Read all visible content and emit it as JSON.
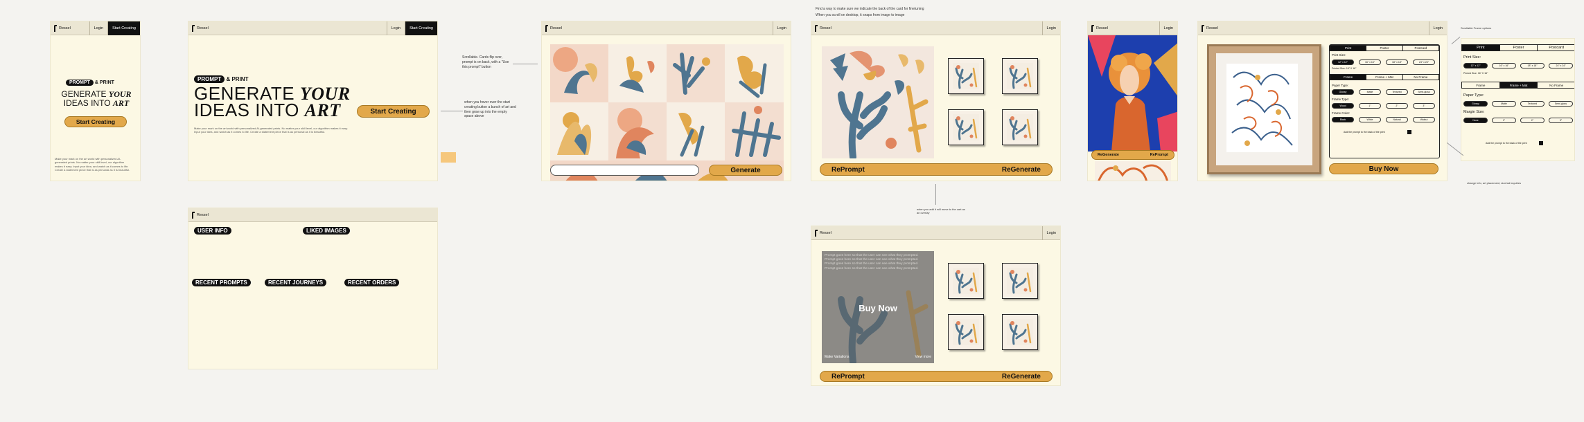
{
  "nav": {
    "brand": "Ressel",
    "login": "Login",
    "start": "Start Creating"
  },
  "hero": {
    "prompt_pill": "PROMPT",
    "print_tag": "& PRINT",
    "line1a": "GENERATE ",
    "line1b": "YOUR",
    "line2a": "IDEAS INTO ",
    "line2b": "ART",
    "cta": "Start Creating",
    "blurb": "Make your mark on the art world with personalized AI-generated prints. No matter your skill level, our algorithm makes it easy. Input your idea, and watch as it comes to life. Create a statement piece that is as personal as it is beautiful."
  },
  "notes": {
    "scrollable": "Scrollable. Cards flip over, prompt is on back, with a \"Use this prompt\" button",
    "hover": "when you hover over the start creating button a bunch of art and then grow up into the empty space above",
    "find_way": "Find a way to make sure we indicate the back of the card for finetuning",
    "desktop": "When you scroll on desktop, it snaps from image to image",
    "add_note": "when you add it will move to the cart as an overlay",
    "scrollable_frame": "Scrollable Frame options",
    "change": "change info, art placement, size/ad inquiries"
  },
  "generate": {
    "input_placeholder": "",
    "button": "Generate"
  },
  "result": {
    "reprompt": "RePrompt",
    "regenerate": "ReGenerate",
    "buy_now": "Buy Now",
    "make_variations": "Make Variations",
    "view_more": "View more",
    "overlay_text": "Prompt goes here so that the user can see what they prompted. Prompt goes here so that the user can see what they prompted. Prompt goes here so that the user can see what they prompted. Prompt goes here so that the user can see what they prompted."
  },
  "profile": {
    "user_info": "USER INFO",
    "liked_images": "LIKED IMAGES",
    "recent_prompts": "RECENT PROMPTS",
    "recent_journeys": "RECENT JOURNEYS",
    "recent_orders": "RECENT ORDERS"
  },
  "config": {
    "tabs": [
      "Print",
      "Poster",
      "Postcard"
    ],
    "print_size_label": "Print Size:",
    "sizes": [
      "12\" x 12\"",
      "16\" x 16\"",
      "18\" x 18\"",
      "24\" x 24\""
    ],
    "selected_size_note": "Printed Size: 16\" X 16\"",
    "frame_tabs": [
      "Frame",
      "Frame + Mat",
      "No Frame"
    ],
    "paper_type_label": "Paper Type:",
    "papers": [
      "Glossy",
      "Matte",
      "Textured",
      "Semi-gloss"
    ],
    "frame_type_label": "Frame Type:",
    "frame_types": [
      "Wood",
      "1\"",
      "2\"",
      "3\""
    ],
    "frame_color_label": "Frame Color:",
    "frame_colors": [
      "Black",
      "White",
      "Natural",
      "Walnut"
    ],
    "margin_label": "Margin Size:",
    "margins": [
      "None",
      "1\"",
      "2\"",
      "3\""
    ],
    "add_prompt": "Add the prompt to the back of the print",
    "buy_now": "Buy Now"
  },
  "mobile_result": {
    "regenerate": "ReGenerate",
    "reprompt": "RePrompt"
  },
  "colors": {
    "cream": "#fcf8e4",
    "accent": "#e2a84a",
    "nav": "#ebe6d3",
    "ink": "#111111",
    "slate": "#4f7590"
  }
}
